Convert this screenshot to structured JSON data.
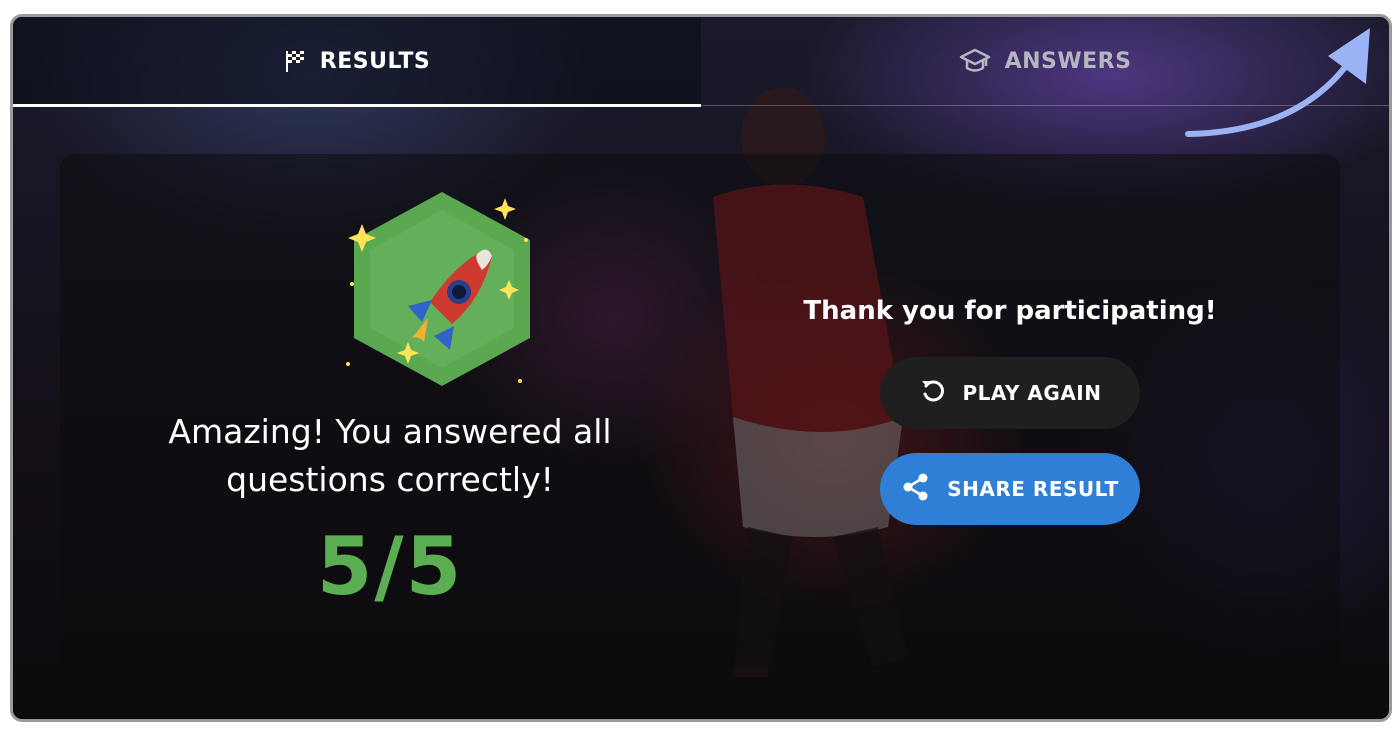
{
  "tabs": {
    "results": {
      "label": "RESULTS",
      "icon": "checkered-flag-icon"
    },
    "answers": {
      "label": "ANSWERS",
      "icon": "graduation-cap-icon"
    }
  },
  "result": {
    "message": "Amazing! You answered all questions correctly!",
    "score": "5/5",
    "badge_icon": "rocket-icon"
  },
  "actions": {
    "thanks": "Thank you for participating!",
    "play_again": "PLAY AGAIN",
    "share_result": "SHARE RESULT"
  },
  "colors": {
    "score": "#5bae52",
    "badge_hex": "#5aa850",
    "share_button": "#2f7fd6",
    "play_button": "#1f1f1f",
    "arrow": "#9ab3f5"
  }
}
